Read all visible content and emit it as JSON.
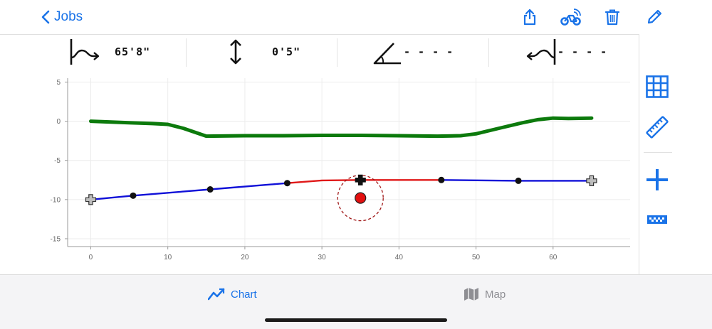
{
  "nav": {
    "back_label": "Jobs"
  },
  "toolbar": {
    "icons": [
      "share-icon",
      "bike-signal-icon",
      "trash-icon",
      "pencil-icon"
    ]
  },
  "stats": {
    "length": "65'8\"",
    "height": "0'5\"",
    "angle": "- - - -",
    "offset": "- - - -"
  },
  "sidebar": {
    "icons": [
      "grid-icon",
      "ruler-icon",
      "plus-icon",
      "checker-bar-icon"
    ]
  },
  "tabs": [
    {
      "label": "Chart",
      "icon": "line-chart-icon",
      "active": true
    },
    {
      "label": "Map",
      "icon": "map-icon",
      "active": false
    }
  ],
  "colors": {
    "accent": "#1a73e8",
    "green_series": "#0c7a0c",
    "blue_series": "#1010d8",
    "red_series": "#e01818",
    "inactive": "#8e8e93"
  },
  "chart_data": {
    "type": "line",
    "xlim": [
      -3,
      70
    ],
    "ylim": [
      -16,
      5.5
    ],
    "xticks": [
      0,
      10,
      20,
      30,
      40,
      50,
      60
    ],
    "yticks": [
      5,
      0,
      -5,
      -10,
      -15
    ],
    "grid": true,
    "series": [
      {
        "color": "#0c7a0c",
        "x": [
          0,
          5,
          8,
          10,
          12,
          15,
          20,
          25,
          30,
          35,
          40,
          45,
          48,
          50,
          53,
          56,
          58,
          60,
          62,
          65
        ],
        "y": [
          0,
          -0.2,
          -0.3,
          -0.4,
          -0.9,
          -1.9,
          -1.85,
          -1.85,
          -1.8,
          -1.8,
          -1.85,
          -1.9,
          -1.85,
          -1.6,
          -0.9,
          -0.2,
          0.2,
          0.4,
          0.35,
          0.4
        ]
      },
      {
        "color": "#1010d8",
        "x": [
          0,
          5.5,
          15.5,
          25.5
        ],
        "y": [
          -10,
          -9.5,
          -8.7,
          -7.9
        ]
      },
      {
        "color": "#e01818",
        "x": [
          25.5,
          30,
          35,
          40,
          45.5
        ],
        "y": [
          -7.9,
          -7.55,
          -7.5,
          -7.5,
          -7.5
        ]
      },
      {
        "color": "#1010d8",
        "x": [
          45.5,
          55.5,
          65
        ],
        "y": [
          -7.5,
          -7.6,
          -7.6
        ]
      }
    ],
    "control_points": [
      {
        "x": 5.5,
        "y": -9.5
      },
      {
        "x": 15.5,
        "y": -8.7
      },
      {
        "x": 25.5,
        "y": -7.9
      },
      {
        "x": 45.5,
        "y": -7.5
      },
      {
        "x": 55.5,
        "y": -7.6
      }
    ],
    "endpoints": [
      {
        "x": 0,
        "y": -10
      },
      {
        "x": 65,
        "y": -7.6
      }
    ],
    "cursor": {
      "x": 35,
      "y": -7.5
    },
    "target": {
      "x": 35,
      "y": -9.8
    }
  }
}
